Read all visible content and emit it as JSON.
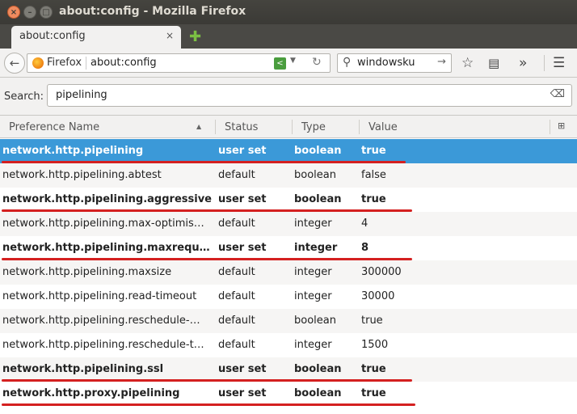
{
  "window": {
    "title": "about:config - Mozilla Firefox"
  },
  "tab": {
    "label": "about:config",
    "close": "×",
    "new_tab": "✚"
  },
  "navbar": {
    "identity_label": "Firefox",
    "url": "about:config",
    "search_value": "windowsku"
  },
  "filter": {
    "label": "Search:",
    "value": "pipelining"
  },
  "columns": {
    "name": "Preference Name",
    "status": "Status",
    "type": "Type",
    "value": "Value"
  },
  "accent_colors": {
    "selection": "#3b99d8",
    "annotation": "#d42020"
  },
  "preferences": [
    {
      "name": "network.http.pipelining",
      "status": "user set",
      "type": "boolean",
      "value": "true",
      "modified": true,
      "selected": true
    },
    {
      "name": "network.http.pipelining.abtest",
      "status": "default",
      "type": "boolean",
      "value": "false",
      "modified": false
    },
    {
      "name": "network.http.pipelining.aggressive",
      "status": "user set",
      "type": "boolean",
      "value": "true",
      "modified": true
    },
    {
      "name": "network.http.pipelining.max-optimis…",
      "status": "default",
      "type": "integer",
      "value": "4",
      "modified": false
    },
    {
      "name": "network.http.pipelining.maxreque…",
      "status": "user set",
      "type": "integer",
      "value": "8",
      "modified": true
    },
    {
      "name": "network.http.pipelining.maxsize",
      "status": "default",
      "type": "integer",
      "value": "300000",
      "modified": false
    },
    {
      "name": "network.http.pipelining.read-timeout",
      "status": "default",
      "type": "integer",
      "value": "30000",
      "modified": false
    },
    {
      "name": "network.http.pipelining.reschedule-…",
      "status": "default",
      "type": "boolean",
      "value": "true",
      "modified": false
    },
    {
      "name": "network.http.pipelining.reschedule-t…",
      "status": "default",
      "type": "integer",
      "value": "1500",
      "modified": false
    },
    {
      "name": "network.http.pipelining.ssl",
      "status": "user set",
      "type": "boolean",
      "value": "true",
      "modified": true
    },
    {
      "name": "network.http.proxy.pipelining",
      "status": "user set",
      "type": "boolean",
      "value": "true",
      "modified": true
    }
  ]
}
